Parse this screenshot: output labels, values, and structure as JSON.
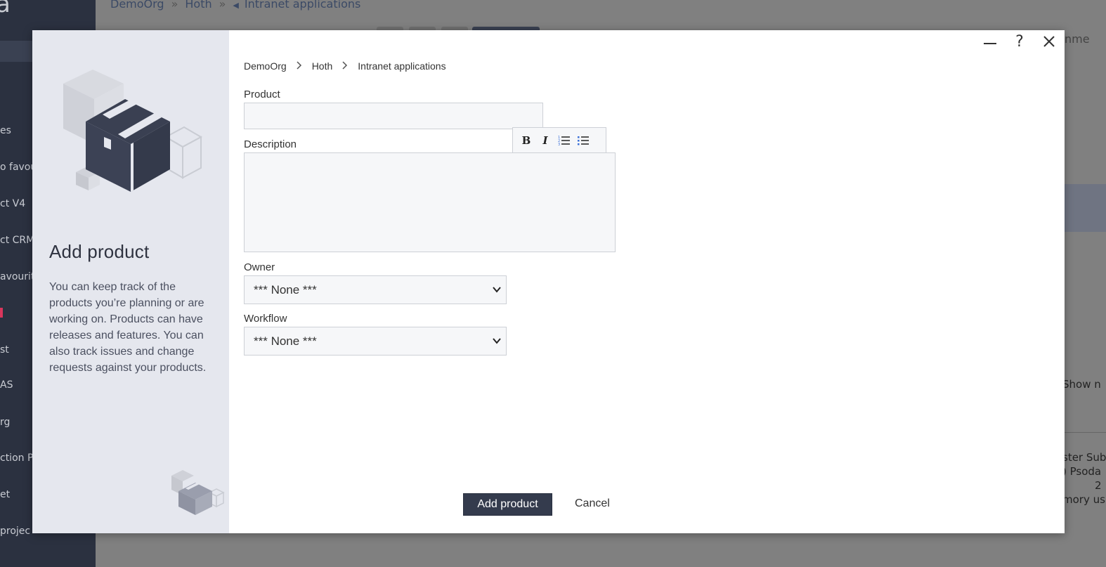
{
  "background": {
    "breadcrumb": [
      "DemoOrg",
      "Hoth",
      "Intranet applications"
    ],
    "breadcrumb_sep": "»",
    "sidebar_items": [
      "es",
      "o favou",
      "ct V4",
      "ct CRM",
      "avourite",
      "st",
      "AS",
      "rg",
      "ction Por",
      "et",
      " projec"
    ],
    "top_right_text": "nme",
    "show_more_text": "Show n",
    "right_lines": [
      "ster Subs",
      ") Psoda",
      "2",
      "mory us"
    ]
  },
  "modal": {
    "title": "Add product",
    "description": "You can keep track of the products you’re planning or are working on. Products can have releases and features. You can also track issues and change requests against your products.",
    "window_controls": {
      "minimize": "—",
      "help": "?",
      "close": "✕"
    },
    "breadcrumb": [
      "DemoOrg",
      "Hoth",
      "Intranet applications"
    ],
    "fields": {
      "product_label": "Product",
      "product_value": "",
      "description_label": "Description",
      "description_value": "",
      "owner_label": "Owner",
      "owner_value": "*** None ***",
      "workflow_label": "Workflow",
      "workflow_value": "*** None ***"
    },
    "toolbar": {
      "bold": "B",
      "italic": "I"
    },
    "buttons": {
      "submit": "Add product",
      "cancel": "Cancel"
    }
  },
  "colors": {
    "overlay": "#8a8a8a",
    "sidebar": "#2b3140",
    "modal_left_panel": "#e5e7ee",
    "primary_button": "#343b4d",
    "input_bg": "#f6f7f9",
    "input_border": "#cdd0d6"
  }
}
